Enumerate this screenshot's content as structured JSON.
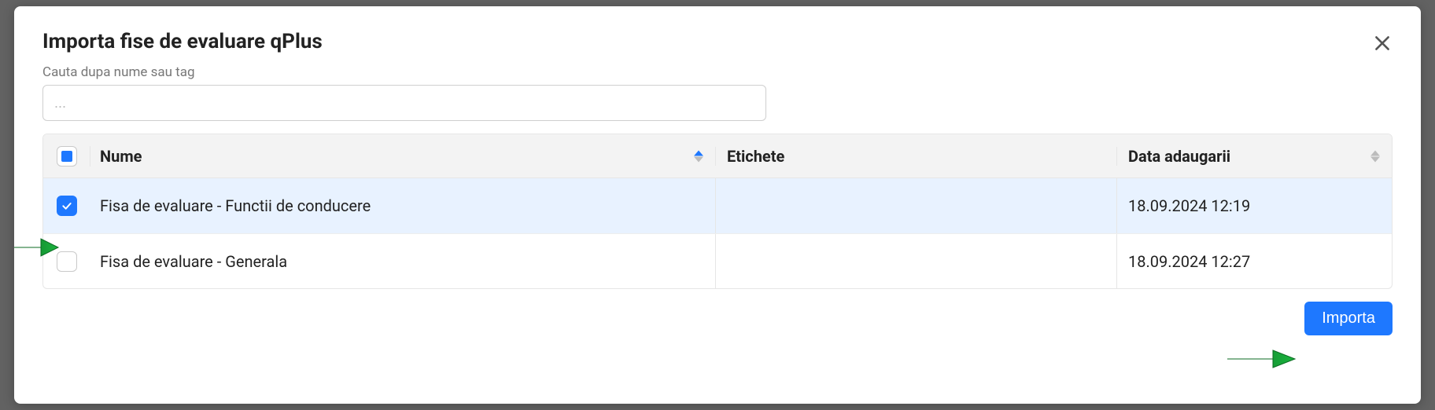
{
  "modal": {
    "title": "Importa fise de evaluare qPlus",
    "close_icon": "close-icon"
  },
  "search": {
    "label": "Cauta dupa nume sau tag",
    "placeholder": "...",
    "value": ""
  },
  "table": {
    "header": {
      "select_all_state": "indeterminate",
      "columns": {
        "name": "Nume",
        "tags": "Etichete",
        "date": "Data adaugarii"
      },
      "sort": {
        "column": "name",
        "direction": "asc"
      }
    },
    "rows": [
      {
        "selected": true,
        "name": "Fisa de evaluare - Functii de conducere",
        "tags": "",
        "date": "18.09.2024 12:19"
      },
      {
        "selected": false,
        "name": "Fisa de evaluare - Generala",
        "tags": "",
        "date": "18.09.2024 12:27"
      }
    ]
  },
  "footer": {
    "import_label": "Importa"
  },
  "annotations": {
    "arrow_color": "#11942e"
  }
}
